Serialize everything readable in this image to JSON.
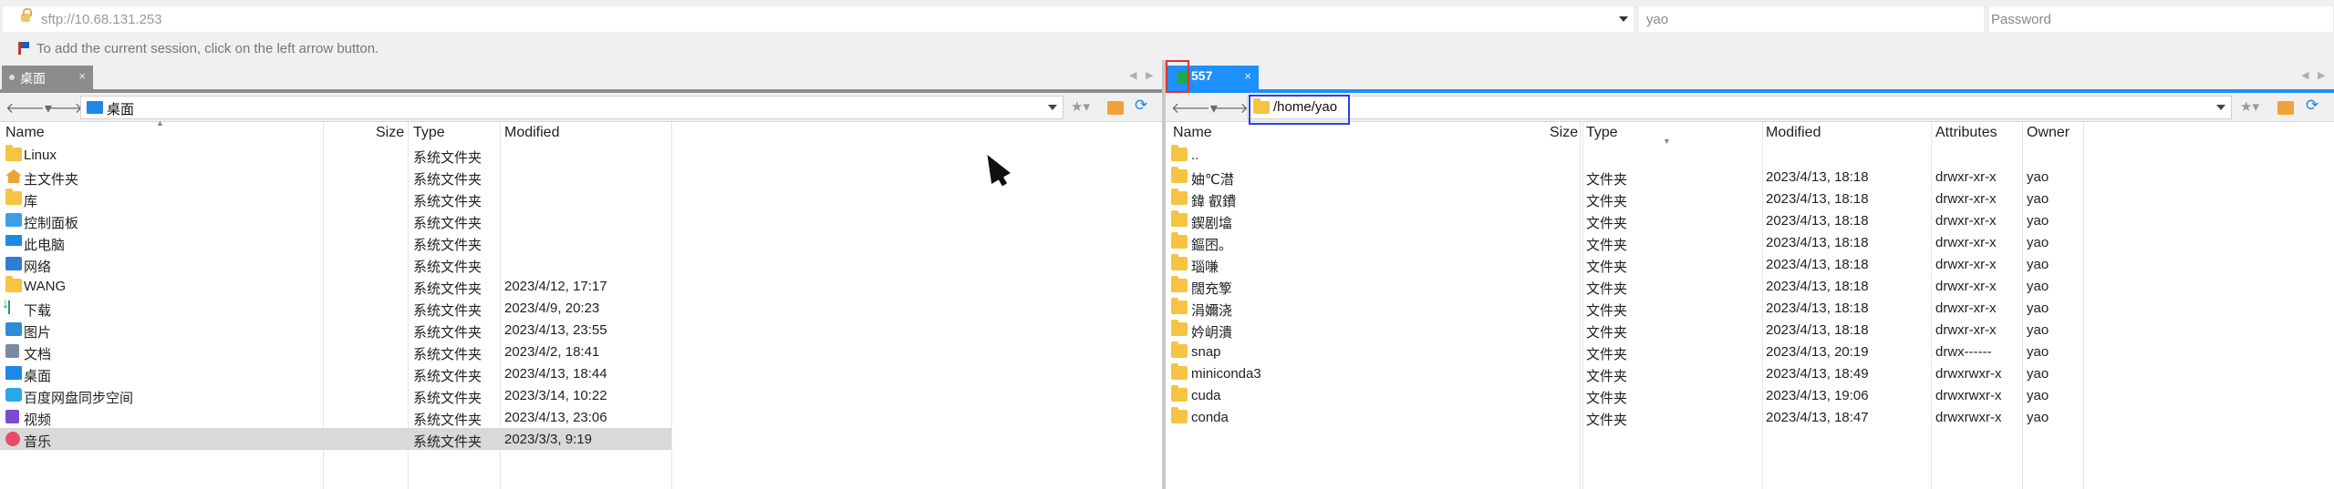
{
  "login": {
    "host": "sftp://10.68.131.253",
    "username": "yao",
    "password_placeholder": "Password"
  },
  "hint": "To add the current session, click on the left arrow button.",
  "left": {
    "tab_label": "桌面",
    "path": "桌面",
    "headers": {
      "name": "Name",
      "size": "Size",
      "type": "Type",
      "modified": "Modified"
    },
    "rows": [
      {
        "icon": "folder-icon",
        "name": "Linux",
        "size": "",
        "type": "系统文件夹",
        "modified": ""
      },
      {
        "icon": "home-icon",
        "name": "主文件夹",
        "size": "",
        "type": "系统文件夹",
        "modified": ""
      },
      {
        "icon": "folder-icon",
        "name": "库",
        "size": "",
        "type": "系统文件夹",
        "modified": ""
      },
      {
        "icon": "control-panel-icon",
        "name": "控制面板",
        "size": "",
        "type": "系统文件夹",
        "modified": ""
      },
      {
        "icon": "computer-icon",
        "name": "此电脑",
        "size": "",
        "type": "系统文件夹",
        "modified": ""
      },
      {
        "icon": "network-icon",
        "name": "网络",
        "size": "",
        "type": "系统文件夹",
        "modified": ""
      },
      {
        "icon": "folder-icon",
        "name": "WANG",
        "size": "",
        "type": "系统文件夹",
        "modified": "2023/4/12, 17:17"
      },
      {
        "icon": "download-icon",
        "name": "下载",
        "size": "",
        "type": "系统文件夹",
        "modified": "2023/4/9, 20:23"
      },
      {
        "icon": "pictures-icon",
        "name": "图片",
        "size": "",
        "type": "系统文件夹",
        "modified": "2023/4/13, 23:55"
      },
      {
        "icon": "documents-icon",
        "name": "文档",
        "size": "",
        "type": "系统文件夹",
        "modified": "2023/4/2, 18:41"
      },
      {
        "icon": "desktop-icon",
        "name": "桌面",
        "size": "",
        "type": "系统文件夹",
        "modified": "2023/4/13, 18:44"
      },
      {
        "icon": "baidu-sync-icon",
        "name": "百度网盘同步空间",
        "size": "",
        "type": "系统文件夹",
        "modified": "2023/3/14, 10:22"
      },
      {
        "icon": "videos-icon",
        "name": "视频",
        "size": "",
        "type": "系统文件夹",
        "modified": "2023/4/13, 23:06"
      },
      {
        "icon": "music-icon",
        "name": "音乐",
        "size": "",
        "type": "系统文件夹",
        "modified": "2023/3/3, 9:19"
      }
    ]
  },
  "right": {
    "tab_label": "557",
    "path": "/home/yao",
    "headers": {
      "name": "Name",
      "size": "Size",
      "type": "Type",
      "modified": "Modified",
      "attributes": "Attributes",
      "owner": "Owner"
    },
    "rows": [
      {
        "name": "..",
        "type": "",
        "modified": "",
        "attributes": "",
        "owner": ""
      },
      {
        "name": "妯℃澘",
        "type": "文件夹",
        "modified": "2023/4/13, 18:18",
        "attributes": "drwxr-xr-x",
        "owner": "yao"
      },
      {
        "name": "鍏 叡鐨",
        "type": "文件夹",
        "modified": "2023/4/13, 18:18",
        "attributes": "drwxr-xr-x",
        "owner": "yao"
      },
      {
        "name": "鍥剧墖",
        "type": "文件夹",
        "modified": "2023/4/13, 18:18",
        "attributes": "drwxr-xr-x",
        "owner": "yao"
      },
      {
        "name": "鏂囨。",
        "type": "文件夹",
        "modified": "2023/4/13, 18:18",
        "attributes": "drwxr-xr-x",
        "owner": "yao"
      },
      {
        "name": "瑙嗛",
        "type": "文件夹",
        "modified": "2023/4/13, 18:18",
        "attributes": "drwxr-xr-x",
        "owner": "yao"
      },
      {
        "name": "闊充箰",
        "type": "文件夹",
        "modified": "2023/4/13, 18:18",
        "attributes": "drwxr-xr-x",
        "owner": "yao"
      },
      {
        "name": "涓嬭浇",
        "type": "文件夹",
        "modified": "2023/4/13, 18:18",
        "attributes": "drwxr-xr-x",
        "owner": "yao"
      },
      {
        "name": "妗岄潰",
        "type": "文件夹",
        "modified": "2023/4/13, 18:18",
        "attributes": "drwxr-xr-x",
        "owner": "yao"
      },
      {
        "name": "snap",
        "type": "文件夹",
        "modified": "2023/4/13, 20:19",
        "attributes": "drwx------",
        "owner": "yao"
      },
      {
        "name": "miniconda3",
        "type": "文件夹",
        "modified": "2023/4/13, 18:49",
        "attributes": "drwxrwxr-x",
        "owner": "yao"
      },
      {
        "name": "cuda",
        "type": "文件夹",
        "modified": "2023/4/13, 19:06",
        "attributes": "drwxrwxr-x",
        "owner": "yao"
      },
      {
        "name": "conda",
        "type": "文件夹",
        "modified": "2023/4/13, 18:47",
        "attributes": "drwxrwxr-x",
        "owner": "yao"
      }
    ]
  }
}
